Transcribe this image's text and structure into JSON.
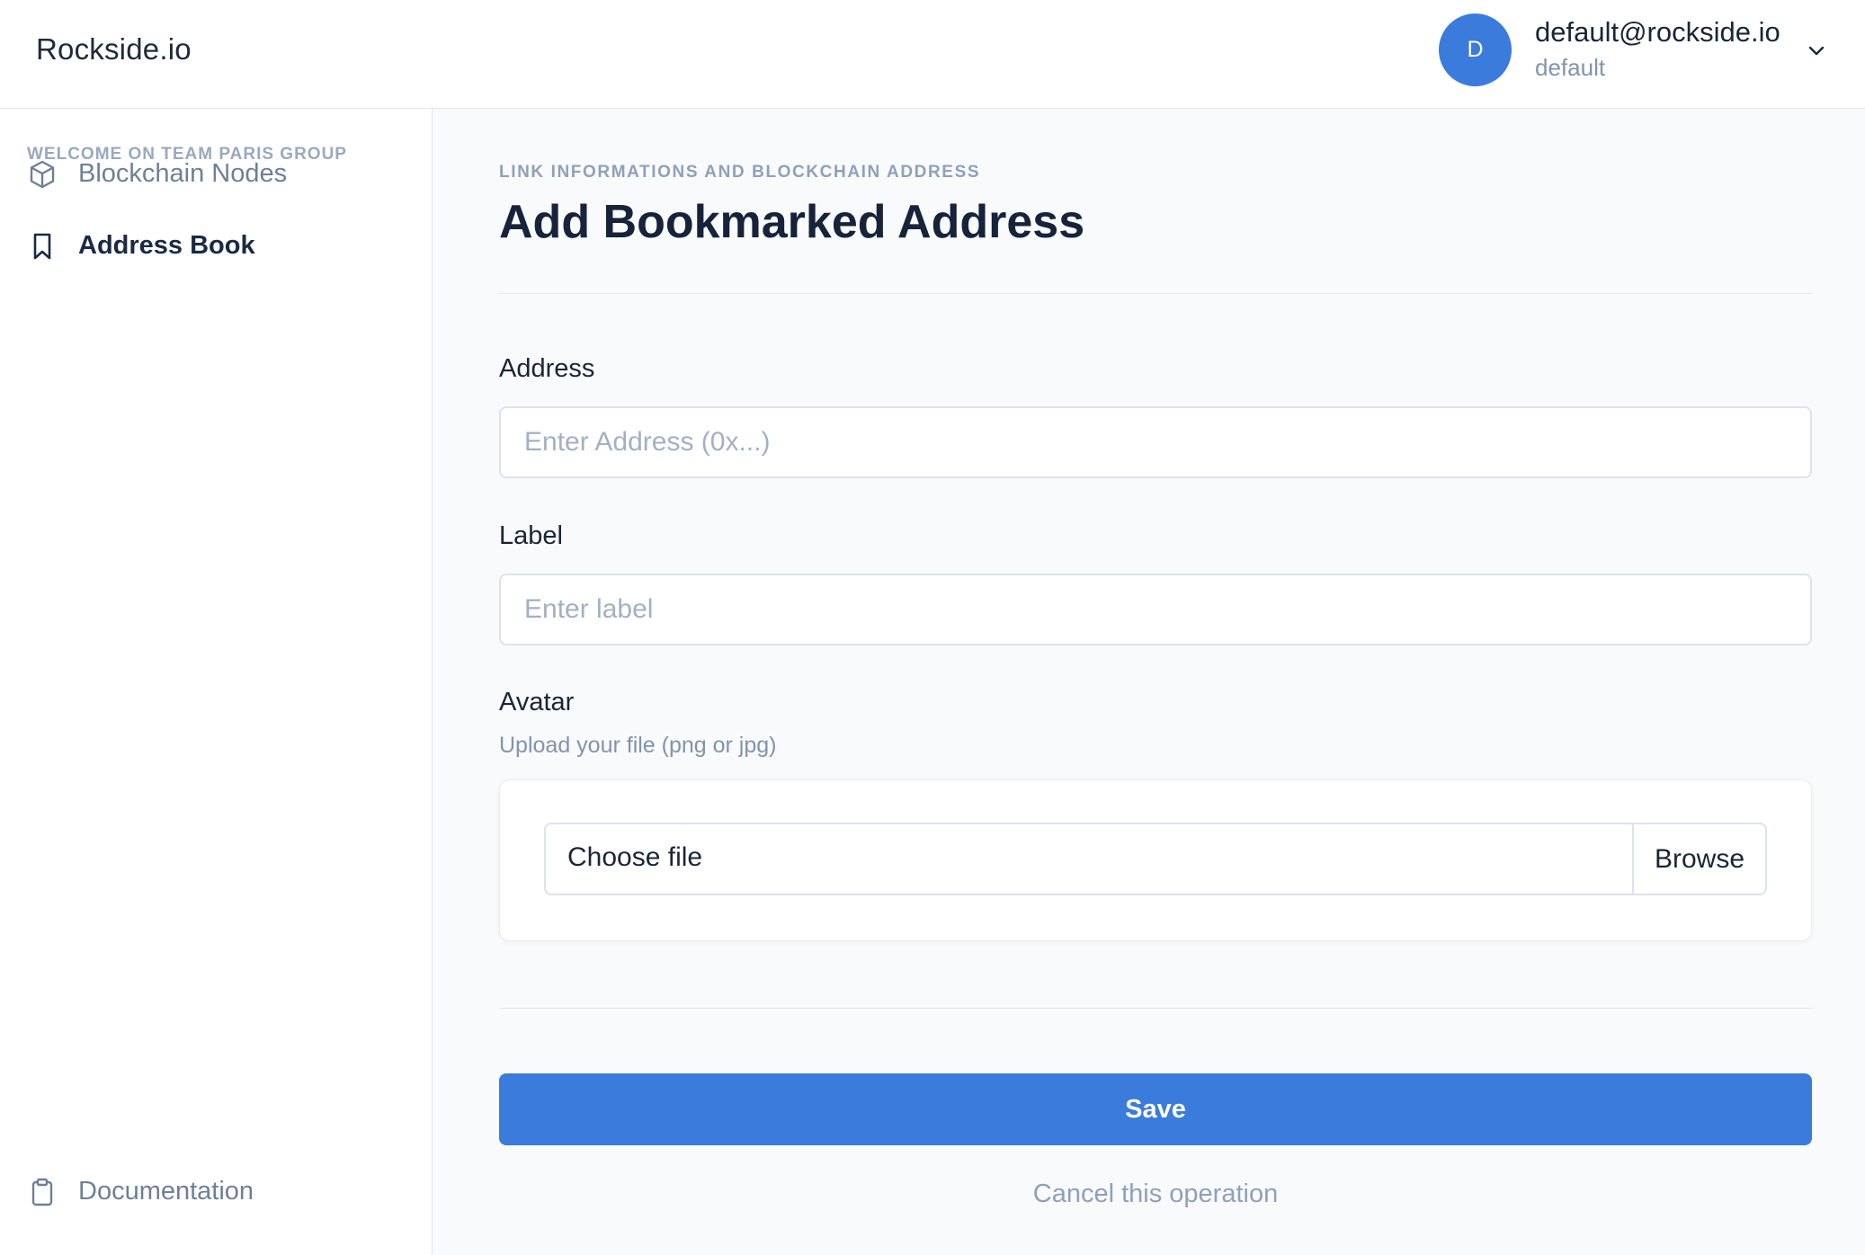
{
  "header": {
    "brand": "Rockside.io",
    "user": {
      "initial": "D",
      "email": "default@rockside.io",
      "team": "default",
      "avatar_color": "#3a7bdc"
    }
  },
  "sidebar": {
    "heading": "WELCOME ON TEAM PARIS GROUP",
    "items": [
      {
        "label": "Blockchain Nodes",
        "icon": "cube-icon",
        "active": false
      },
      {
        "label": "Address Book",
        "icon": "bookmark-icon",
        "active": true
      }
    ],
    "footer_item": {
      "label": "Documentation",
      "icon": "clipboard-icon"
    }
  },
  "main": {
    "eyebrow": "LINK INFORMATIONS AND BLOCKCHAIN ADDRESS",
    "title": "Add Bookmarked Address",
    "form": {
      "address": {
        "label": "Address",
        "value": "",
        "placeholder": "Enter Address (0x...)"
      },
      "label": {
        "label": "Label",
        "value": "",
        "placeholder": "Enter label"
      },
      "avatar": {
        "label": "Avatar",
        "help": "Upload your file (png or jpg)",
        "file_text": "Choose file",
        "browse_label": "Browse"
      }
    },
    "save_label": "Save",
    "cancel_label": "Cancel this operation"
  },
  "colors": {
    "accent": "#3a7bdc",
    "muted_text": "#8fa0ba",
    "border": "#dde3eb"
  }
}
